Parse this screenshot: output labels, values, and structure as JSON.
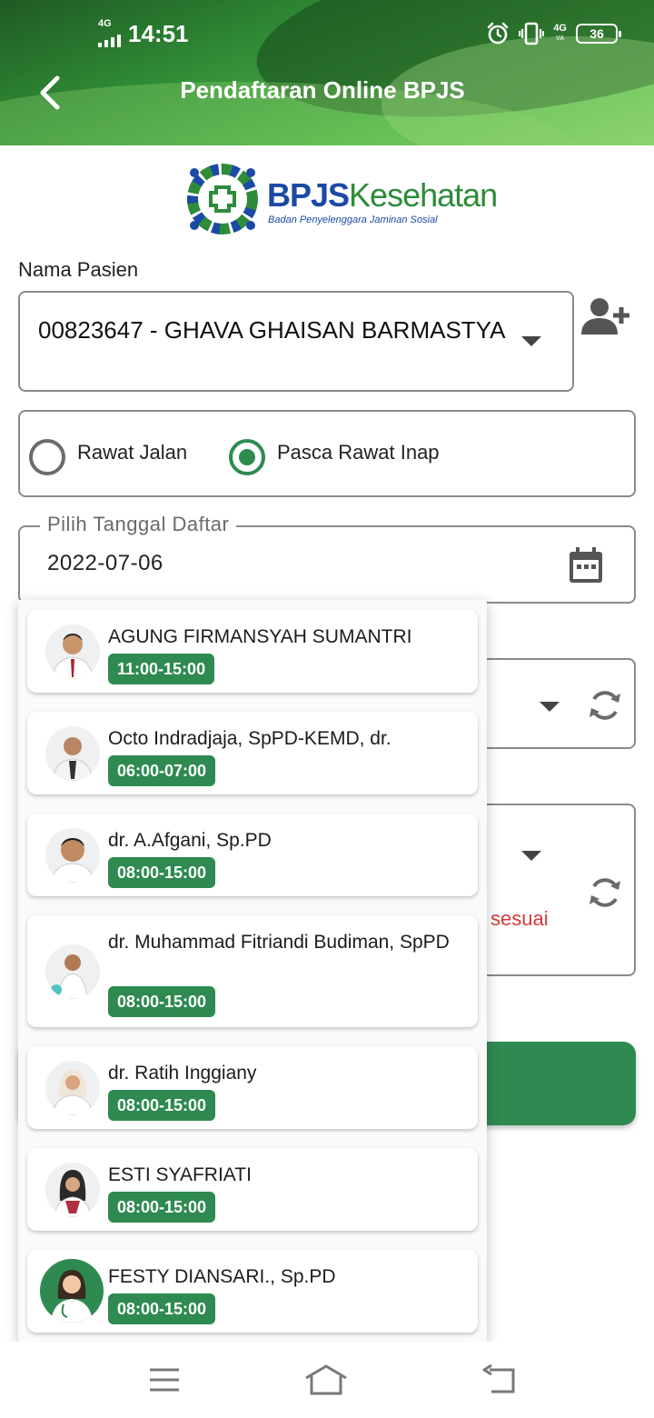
{
  "status_bar": {
    "network": "4G",
    "time": "14:51",
    "network_right": "4G",
    "network_right_sub": "VA",
    "battery": "36"
  },
  "app_bar": {
    "title": "Pendaftaran Online BPJS",
    "back_icon": "arrow-left-icon"
  },
  "logo": {
    "name_part1": "BPJS",
    "name_part2": "Kesehatan",
    "subtitle": "Badan Penyelenggara Jaminan Sosial"
  },
  "form": {
    "patient_label": "Nama Pasien",
    "patient_value": "00823647 - GHAVA GHAISAN BARMASTYA",
    "add_patient_icon": "person-add-icon",
    "visit_types": [
      {
        "label": "Rawat Jalan",
        "selected": false
      },
      {
        "label": "Pasca Rawat Inap",
        "selected": true
      }
    ],
    "date_label": "Pilih Tanggal Daftar",
    "date_value": "2022-07-06",
    "warning_fragment": "sesuai"
  },
  "doctor_list": [
    {
      "name": "AGUNG FIRMANSYAH SUMANTRI",
      "schedule": "11:00-15:00"
    },
    {
      "name": "Octo Indradjaja, SpPD-KEMD, dr.",
      "schedule": "06:00-07:00"
    },
    {
      "name": "dr. A.Afgani, Sp.PD",
      "schedule": "08:00-15:00"
    },
    {
      "name": "dr. Muhammad Fitriandi Budiman, SpPD",
      "schedule": "08:00-15:00"
    },
    {
      "name": "dr. Ratih Inggiany",
      "schedule": "08:00-15:00"
    },
    {
      "name": "ESTI SYAFRIATI",
      "schedule": "08:00-15:00"
    },
    {
      "name": "FESTY DIANSARI., Sp.PD",
      "schedule": "08:00-15:00"
    }
  ],
  "colors": {
    "primary_green": "#2e8a50",
    "warning_red": "#d33a3a",
    "logo_blue": "#1b4aa5"
  }
}
